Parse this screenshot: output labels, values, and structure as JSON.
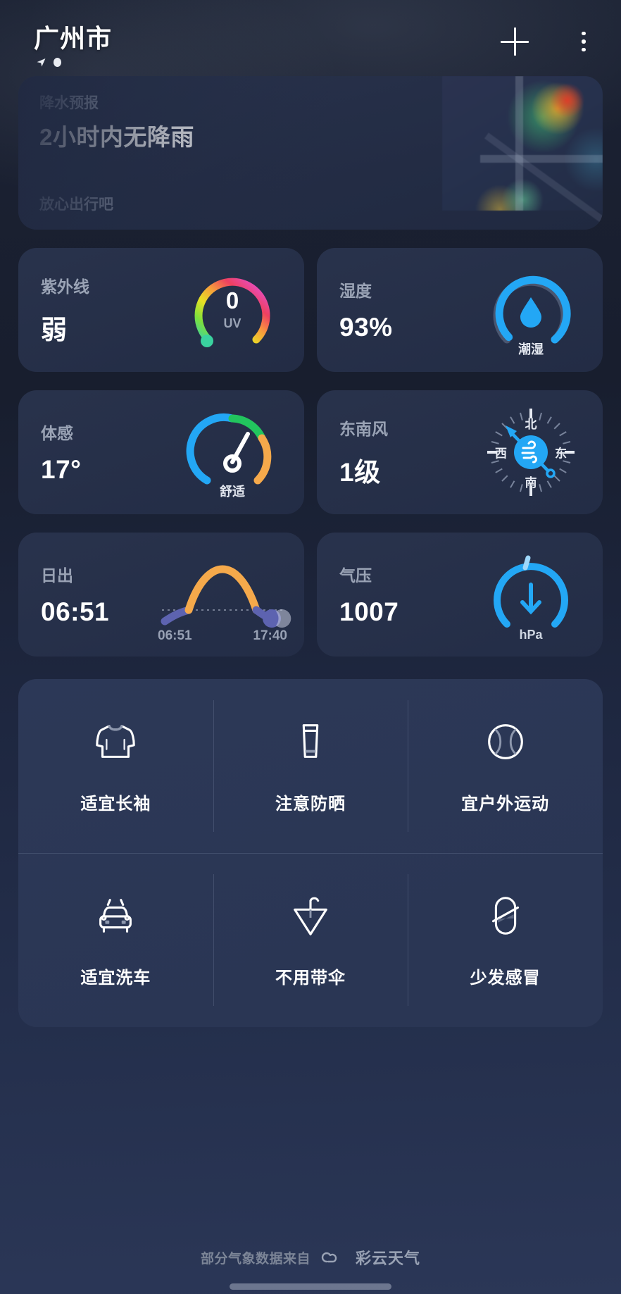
{
  "header": {
    "city": "广州市",
    "location_icon": "location-arrow-icon",
    "add_label": "+",
    "menu_label": "⋮"
  },
  "precipitation": {
    "label": "降水预报",
    "headline": "2小时内无降雨",
    "footnote": "放心出行吧",
    "map_icon": "radar-map-thumbnail"
  },
  "metrics": [
    {
      "name": "uv",
      "label": "紫外线",
      "value": "弱",
      "gauge_value": "0",
      "gauge_unit": "UV",
      "gauge_sub": "",
      "accent": "#3ad29f"
    },
    {
      "name": "humidity",
      "label": "湿度",
      "value": "93%",
      "gauge_value": "",
      "gauge_unit": "",
      "gauge_sub": "潮湿",
      "accent": "#23a7f5"
    },
    {
      "name": "feels-like",
      "label": "体感",
      "value": "17°",
      "gauge_value": "",
      "gauge_unit": "",
      "gauge_sub": "舒适",
      "accent": "#22c55e"
    },
    {
      "name": "wind",
      "label": "东南风",
      "value": "1级",
      "compass": {
        "north": "北",
        "east": "东",
        "south": "南",
        "west": "西"
      },
      "accent": "#23a7f5"
    },
    {
      "name": "sunrise",
      "label": "日出",
      "value": "06:51",
      "sunrise_time": "06:51",
      "sunset_time": "17:40",
      "accent": "#f5a94b"
    },
    {
      "name": "pressure",
      "label": "气压",
      "value": "1007",
      "gauge_unit": "hPa",
      "trend_icon": "arrow-down-icon",
      "accent": "#23a7f5"
    }
  ],
  "tiles": [
    {
      "icon": "long-sleeve-shirt-icon",
      "label": "适宜长袖"
    },
    {
      "icon": "sunscreen-tube-icon",
      "label": "注意防晒"
    },
    {
      "icon": "tennis-ball-icon",
      "label": "宜户外运动"
    },
    {
      "icon": "car-wash-icon",
      "label": "适宜洗车"
    },
    {
      "icon": "umbrella-icon",
      "label": "不用带伞"
    },
    {
      "icon": "pill-capsule-icon",
      "label": "少发感冒"
    }
  ],
  "footer": {
    "attribution": "部分气象数据来自",
    "brand": "彩云天气",
    "brand_icon": "cloud-icon"
  },
  "colors": {
    "background_top": "#1b2233",
    "background_bottom": "#2b3757",
    "card": "#2a344e",
    "accent_blue": "#23a7f5",
    "accent_green": "#22c55e",
    "accent_orange": "#f5a94b",
    "text_primary": "#ffffff",
    "text_secondary": "#9aa3b5"
  }
}
